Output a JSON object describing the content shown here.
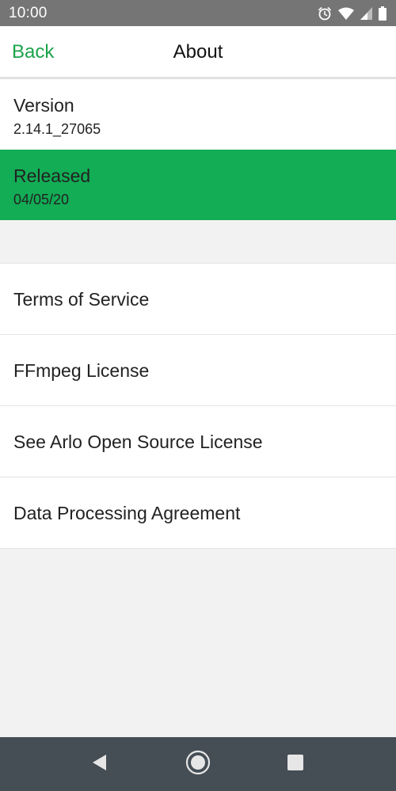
{
  "status_bar": {
    "time": "10:00",
    "icons": [
      "alarm-icon",
      "wifi-icon",
      "signal-icon",
      "battery-icon"
    ]
  },
  "header": {
    "back_label": "Back",
    "title": "About"
  },
  "info": {
    "version": {
      "label": "Version",
      "value": "2.14.1_27065"
    },
    "released": {
      "label": "Released",
      "value": "04/05/20"
    }
  },
  "links": [
    {
      "label": "Terms of Service"
    },
    {
      "label": "FFmpeg License"
    },
    {
      "label": "See Arlo Open Source License"
    },
    {
      "label": "Data Processing Agreement"
    }
  ],
  "nav_bar": {
    "icons": [
      "back-triangle-icon",
      "home-circle-icon",
      "recents-square-icon"
    ]
  },
  "colors": {
    "accent": "#1aa34a",
    "selected_row": "#12ad55",
    "status_bar": "#757575",
    "nav_bar": "#454d55",
    "background": "#f2f2f2"
  }
}
